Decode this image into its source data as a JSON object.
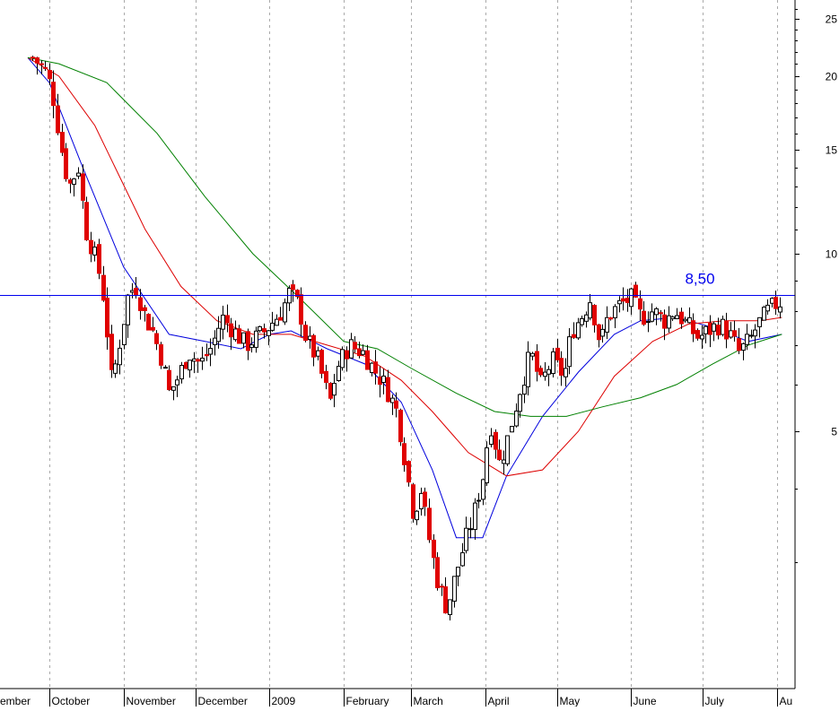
{
  "chart_data": {
    "type": "candlestick",
    "y_scale": "log",
    "ylim": [
      2.2,
      27
    ],
    "y_ticks": [
      5,
      10,
      15,
      20,
      25
    ],
    "x_labels": [
      "ember",
      "October",
      "November",
      "December",
      "2009",
      "February",
      "March",
      "April",
      "May",
      "June",
      "July",
      "Au"
    ],
    "x_label_dates": [
      "2008-09",
      "2008-10",
      "2008-11",
      "2008-12",
      "2009-01",
      "2009-02",
      "2009-03",
      "2009-04",
      "2009-05",
      "2009-06",
      "2009-07",
      "2009-08"
    ],
    "reference_line": {
      "value": 8.5,
      "label": "8,50"
    },
    "grid": {
      "vertical_dashed": true,
      "horizontal": false
    },
    "colors": {
      "up_candle": "#ffffff",
      "down_candle": "#e00000",
      "candle_outline": "#000000",
      "fast_ma": "#0000dd",
      "mid_ma": "#dd0000",
      "slow_ma": "#008000",
      "reference_line": "#0000ee"
    },
    "close_path": [
      [
        "2008-09-24",
        21.5
      ],
      [
        "2008-09-29",
        20.5
      ],
      [
        "2008-10-02",
        19.0
      ],
      [
        "2008-10-06",
        15.0
      ],
      [
        "2008-10-09",
        13.0
      ],
      [
        "2008-10-13",
        14.0
      ],
      [
        "2008-10-16",
        11.0
      ],
      [
        "2008-10-21",
        9.6
      ],
      [
        "2008-10-24",
        8.2
      ],
      [
        "2008-10-27",
        6.0
      ],
      [
        "2008-10-30",
        7.0
      ],
      [
        "2008-11-03",
        8.6
      ],
      [
        "2008-11-06",
        8.8
      ],
      [
        "2008-11-10",
        7.8
      ],
      [
        "2008-11-13",
        7.4
      ],
      [
        "2008-11-17",
        6.6
      ],
      [
        "2008-11-20",
        5.8
      ],
      [
        "2008-11-24",
        6.2
      ],
      [
        "2008-11-28",
        6.8
      ],
      [
        "2008-12-03",
        6.5
      ],
      [
        "2008-12-08",
        7.0
      ],
      [
        "2008-12-12",
        7.8
      ],
      [
        "2008-12-17",
        7.4
      ],
      [
        "2008-12-22",
        7.0
      ],
      [
        "2008-12-30",
        7.4
      ],
      [
        "2009-01-06",
        8.0
      ],
      [
        "2009-01-09",
        8.6
      ],
      [
        "2009-01-13",
        8.2
      ],
      [
        "2009-01-16",
        7.2
      ],
      [
        "2009-01-21",
        6.6
      ],
      [
        "2009-01-26",
        5.6
      ],
      [
        "2009-01-29",
        6.4
      ],
      [
        "2009-02-03",
        7.0
      ],
      [
        "2009-02-09",
        6.8
      ],
      [
        "2009-02-13",
        6.4
      ],
      [
        "2009-02-18",
        6.0
      ],
      [
        "2009-02-23",
        5.4
      ],
      [
        "2009-02-26",
        4.6
      ],
      [
        "2009-03-02",
        3.6
      ],
      [
        "2009-03-05",
        4.0
      ],
      [
        "2009-03-09",
        3.2
      ],
      [
        "2009-03-12",
        2.8
      ],
      [
        "2009-03-16",
        2.5
      ],
      [
        "2009-03-19",
        2.8
      ],
      [
        "2009-03-23",
        3.2
      ],
      [
        "2009-03-27",
        3.6
      ],
      [
        "2009-03-31",
        4.2
      ],
      [
        "2009-04-03",
        5.2
      ],
      [
        "2009-04-07",
        4.4
      ],
      [
        "2009-04-10",
        4.8
      ],
      [
        "2009-04-15",
        5.8
      ],
      [
        "2009-04-20",
        6.8
      ],
      [
        "2009-04-24",
        6.0
      ],
      [
        "2009-04-29",
        6.6
      ],
      [
        "2009-05-04",
        6.2
      ],
      [
        "2009-05-07",
        7.4
      ],
      [
        "2009-05-11",
        7.8
      ],
      [
        "2009-05-15",
        8.4
      ],
      [
        "2009-05-19",
        7.0
      ],
      [
        "2009-05-22",
        7.8
      ],
      [
        "2009-05-27",
        8.2
      ],
      [
        "2009-06-01",
        8.4
      ],
      [
        "2009-06-05",
        7.8
      ],
      [
        "2009-06-10",
        8.0
      ],
      [
        "2009-06-15",
        7.7
      ],
      [
        "2009-06-19",
        8.0
      ],
      [
        "2009-06-24",
        7.6
      ],
      [
        "2009-06-29",
        7.2
      ],
      [
        "2009-07-03",
        7.4
      ],
      [
        "2009-07-08",
        7.6
      ],
      [
        "2009-07-13",
        7.2
      ],
      [
        "2009-07-16",
        6.8
      ],
      [
        "2009-07-21",
        7.2
      ],
      [
        "2009-07-24",
        7.6
      ],
      [
        "2009-07-28",
        8.0
      ],
      [
        "2009-07-31",
        8.2
      ],
      [
        "2009-08-03",
        8.3
      ]
    ],
    "moving_averages": [
      {
        "color_key": "fast_ma",
        "points": [
          [
            "2008-09-22",
            21.5
          ],
          [
            "2008-10-01",
            19.5
          ],
          [
            "2008-10-15",
            14.0
          ],
          [
            "2008-11-01",
            9.5
          ],
          [
            "2008-11-20",
            7.3
          ],
          [
            "2008-12-05",
            7.1
          ],
          [
            "2008-12-20",
            6.9
          ],
          [
            "2009-01-01",
            7.3
          ],
          [
            "2009-01-10",
            7.4
          ],
          [
            "2009-01-25",
            6.9
          ],
          [
            "2009-02-10",
            6.5
          ],
          [
            "2009-02-25",
            5.6
          ],
          [
            "2009-03-10",
            4.3
          ],
          [
            "2009-03-20",
            3.3
          ],
          [
            "2009-03-31",
            3.3
          ],
          [
            "2009-04-10",
            4.2
          ],
          [
            "2009-04-25",
            5.3
          ],
          [
            "2009-05-10",
            6.3
          ],
          [
            "2009-05-25",
            7.3
          ],
          [
            "2009-06-05",
            7.7
          ],
          [
            "2009-06-20",
            7.8
          ],
          [
            "2009-07-05",
            7.5
          ],
          [
            "2009-07-20",
            7.1
          ],
          [
            "2009-08-03",
            7.3
          ]
        ]
      },
      {
        "color_key": "mid_ma",
        "points": [
          [
            "2008-09-22",
            21.5
          ],
          [
            "2008-10-05",
            20.0
          ],
          [
            "2008-10-20",
            16.5
          ],
          [
            "2008-11-10",
            11.0
          ],
          [
            "2008-11-25",
            8.8
          ],
          [
            "2008-12-10",
            7.7
          ],
          [
            "2008-12-25",
            7.3
          ],
          [
            "2009-01-10",
            7.3
          ],
          [
            "2009-01-25",
            7.0
          ],
          [
            "2009-02-10",
            6.7
          ],
          [
            "2009-02-25",
            6.1
          ],
          [
            "2009-03-10",
            5.4
          ],
          [
            "2009-03-25",
            4.6
          ],
          [
            "2009-04-10",
            4.2
          ],
          [
            "2009-04-25",
            4.3
          ],
          [
            "2009-05-10",
            5.0
          ],
          [
            "2009-05-25",
            6.2
          ],
          [
            "2009-06-10",
            7.1
          ],
          [
            "2009-06-25",
            7.6
          ],
          [
            "2009-07-10",
            7.7
          ],
          [
            "2009-07-25",
            7.7
          ],
          [
            "2009-08-03",
            7.8
          ]
        ]
      },
      {
        "color_key": "slow_ma",
        "points": [
          [
            "2008-09-22",
            21.5
          ],
          [
            "2008-10-05",
            21.0
          ],
          [
            "2008-10-25",
            19.5
          ],
          [
            "2008-11-15",
            16.0
          ],
          [
            "2008-12-05",
            12.5
          ],
          [
            "2008-12-25",
            10.0
          ],
          [
            "2009-01-15",
            8.3
          ],
          [
            "2009-02-01",
            7.1
          ],
          [
            "2009-02-15",
            6.9
          ],
          [
            "2009-03-01",
            6.4
          ],
          [
            "2009-03-20",
            5.8
          ],
          [
            "2009-04-05",
            5.4
          ],
          [
            "2009-04-20",
            5.3
          ],
          [
            "2009-05-05",
            5.3
          ],
          [
            "2009-05-20",
            5.5
          ],
          [
            "2009-06-05",
            5.7
          ],
          [
            "2009-06-20",
            6.0
          ],
          [
            "2009-07-05",
            6.5
          ],
          [
            "2009-07-20",
            7.0
          ],
          [
            "2009-08-03",
            7.3
          ]
        ]
      }
    ]
  }
}
